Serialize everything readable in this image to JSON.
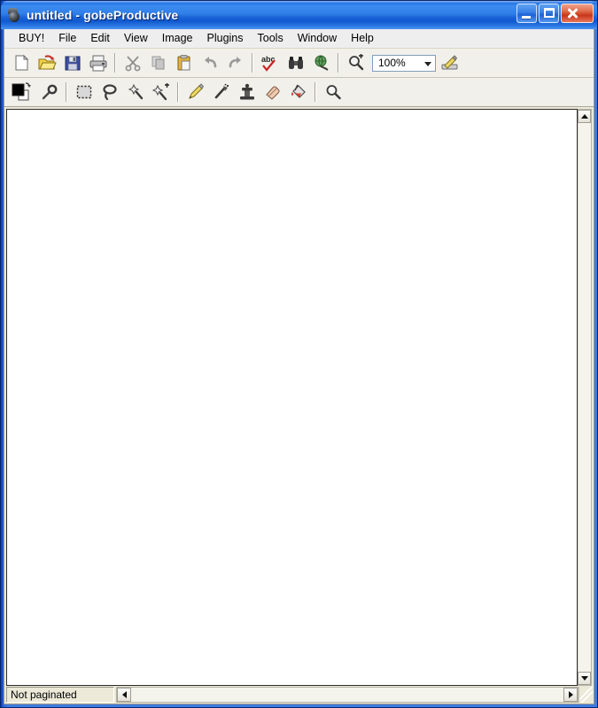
{
  "window": {
    "title": "untitled - gobeProductive",
    "app_icon": "app-ball-icon",
    "buttons": {
      "minimize": "Minimize",
      "maximize": "Maximize",
      "close": "Close"
    }
  },
  "menu": {
    "items": [
      {
        "label": "BUY!"
      },
      {
        "label": "File"
      },
      {
        "label": "Edit"
      },
      {
        "label": "View"
      },
      {
        "label": "Image"
      },
      {
        "label": "Plugins"
      },
      {
        "label": "Tools"
      },
      {
        "label": "Window"
      },
      {
        "label": "Help"
      }
    ]
  },
  "toolbar_main": {
    "buttons": [
      {
        "name": "new-document-button",
        "icon": "new-page-icon",
        "tooltip": "New"
      },
      {
        "name": "open-document-button",
        "icon": "open-folder-icon",
        "tooltip": "Open"
      },
      {
        "name": "save-document-button",
        "icon": "floppy-disk-icon",
        "tooltip": "Save"
      },
      {
        "name": "print-button",
        "icon": "printer-icon",
        "tooltip": "Print"
      },
      {
        "name": "cut-button",
        "icon": "scissors-icon",
        "tooltip": "Cut"
      },
      {
        "name": "copy-button",
        "icon": "copy-pages-icon",
        "tooltip": "Copy"
      },
      {
        "name": "paste-button",
        "icon": "clipboard-icon",
        "tooltip": "Paste"
      },
      {
        "name": "undo-button",
        "icon": "undo-arrow-icon",
        "tooltip": "Undo"
      },
      {
        "name": "redo-button",
        "icon": "redo-arrow-icon",
        "tooltip": "Redo"
      },
      {
        "name": "spellcheck-button",
        "icon": "abc-check-icon",
        "tooltip": "Spell Check"
      },
      {
        "name": "find-button",
        "icon": "binoculars-icon",
        "tooltip": "Find"
      },
      {
        "name": "web-button",
        "icon": "globe-icon",
        "tooltip": "Web"
      },
      {
        "name": "zoom-in-button",
        "icon": "magnifier-plus-icon",
        "tooltip": "Zoom In"
      },
      {
        "name": "edit-mode-button",
        "icon": "pencil-pad-icon",
        "tooltip": "Edit"
      }
    ],
    "zoom": {
      "value": "100%",
      "arrow_icon": "chevron-down-icon"
    }
  },
  "toolbar_tools": {
    "color_swatches": {
      "name": "foreground-background-color",
      "foreground": "#000000",
      "background": "#ffffff",
      "swap_icon": "swap-colors-icon"
    },
    "buttons": [
      {
        "name": "color-picker-tool",
        "icon": "eyedropper-icon",
        "tooltip": "Color Picker"
      },
      {
        "name": "rectangular-marquee-tool",
        "icon": "marquee-icon",
        "tooltip": "Rectangular Select"
      },
      {
        "name": "lasso-tool",
        "icon": "lasso-icon",
        "tooltip": "Lasso"
      },
      {
        "name": "magic-wand-tool",
        "icon": "magic-wand-icon",
        "tooltip": "Magic Wand"
      },
      {
        "name": "magic-wand-add-tool",
        "icon": "magic-wand-plus-icon",
        "tooltip": "Magic Wand Add"
      },
      {
        "name": "pencil-tool",
        "icon": "pencil-icon",
        "tooltip": "Pencil"
      },
      {
        "name": "airbrush-tool",
        "icon": "airbrush-icon",
        "tooltip": "Airbrush"
      },
      {
        "name": "clone-stamp-tool",
        "icon": "clone-stamp-icon",
        "tooltip": "Clone Stamp"
      },
      {
        "name": "eraser-tool",
        "icon": "eraser-icon",
        "tooltip": "Eraser"
      },
      {
        "name": "paint-bucket-tool",
        "icon": "paint-bucket-icon",
        "tooltip": "Fill"
      },
      {
        "name": "zoom-tool",
        "icon": "magnifier-icon",
        "tooltip": "Zoom"
      }
    ]
  },
  "document": {
    "canvas_background": "#ffffff"
  },
  "scrollbars": {
    "vertical": {
      "up_icon": "arrow-up-icon",
      "down_icon": "arrow-down-icon"
    },
    "horizontal": {
      "left_icon": "arrow-left-icon",
      "right_icon": "arrow-right-icon"
    }
  },
  "status_bar": {
    "text": "Not paginated",
    "resize_grip": "resize-grip-icon"
  }
}
